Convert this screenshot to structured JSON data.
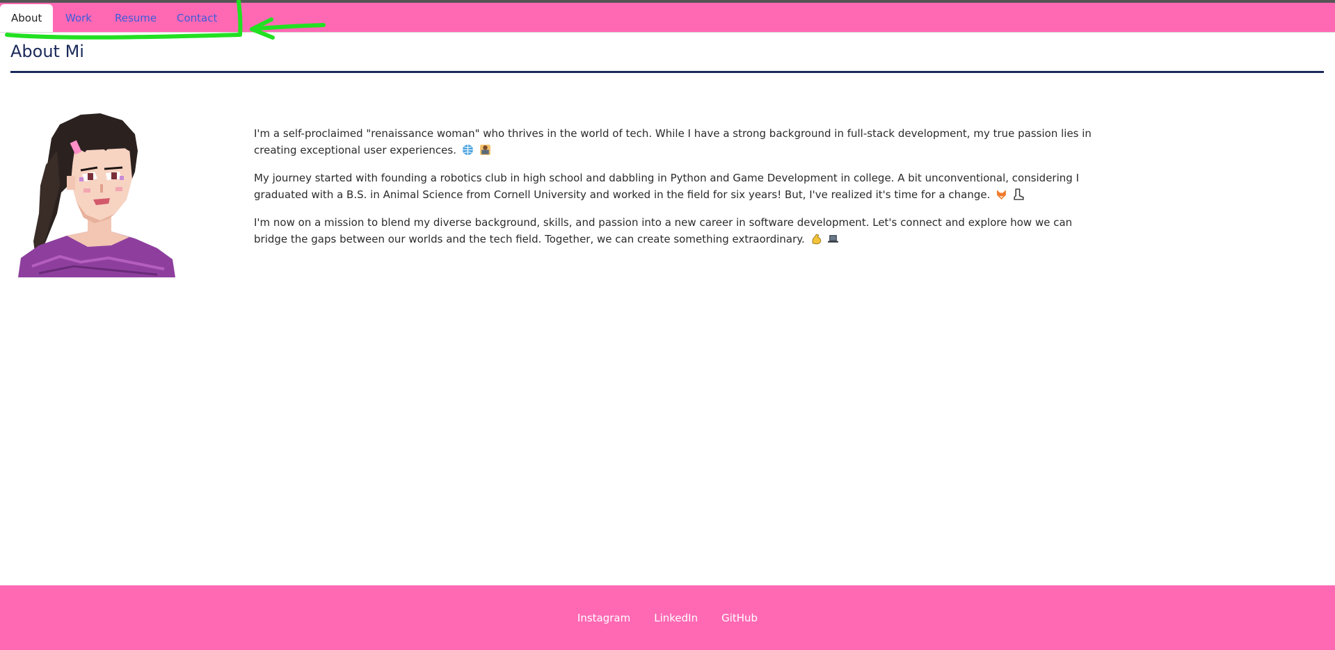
{
  "nav": {
    "tabs": [
      {
        "label": "About",
        "active": true
      },
      {
        "label": "Work",
        "active": false
      },
      {
        "label": "Resume",
        "active": false
      },
      {
        "label": "Contact",
        "active": false
      }
    ]
  },
  "main": {
    "title": "About Mi",
    "paragraphs": [
      {
        "text": "I'm a self-proclaimed \"renaissance woman\" who thrives in the world of tech. While I have a strong background in full-stack development, my true passion lies in creating exceptional user experiences.",
        "emojis": [
          "globe-icon",
          "computer-user-icon"
        ]
      },
      {
        "text": "My journey started with founding a robotics club in high school and dabbling in Python and Game Development in college. A bit unconventional, considering I graduated with a B.S. in Animal Science from Cornell University and worked in the field for six years! But, I've realized it's time for a change.",
        "emojis": [
          "fox-icon",
          "boot-icon"
        ]
      },
      {
        "text": "I'm now on a mission to blend my diverse background, skills, and passion into a new career in software development. Let's connect and explore how we can bridge the gaps between our worlds and the tech field. Together, we can create something extraordinary.",
        "emojis": [
          "flexed-biceps-icon",
          "laptop-icon"
        ]
      }
    ]
  },
  "footer": {
    "links": [
      "Instagram",
      "LinkedIn",
      "GitHub"
    ]
  },
  "colors": {
    "accent": "#ff69b4",
    "title": "#1a2a5a",
    "link": "#3a5bd9",
    "annotation": "#22e022"
  }
}
